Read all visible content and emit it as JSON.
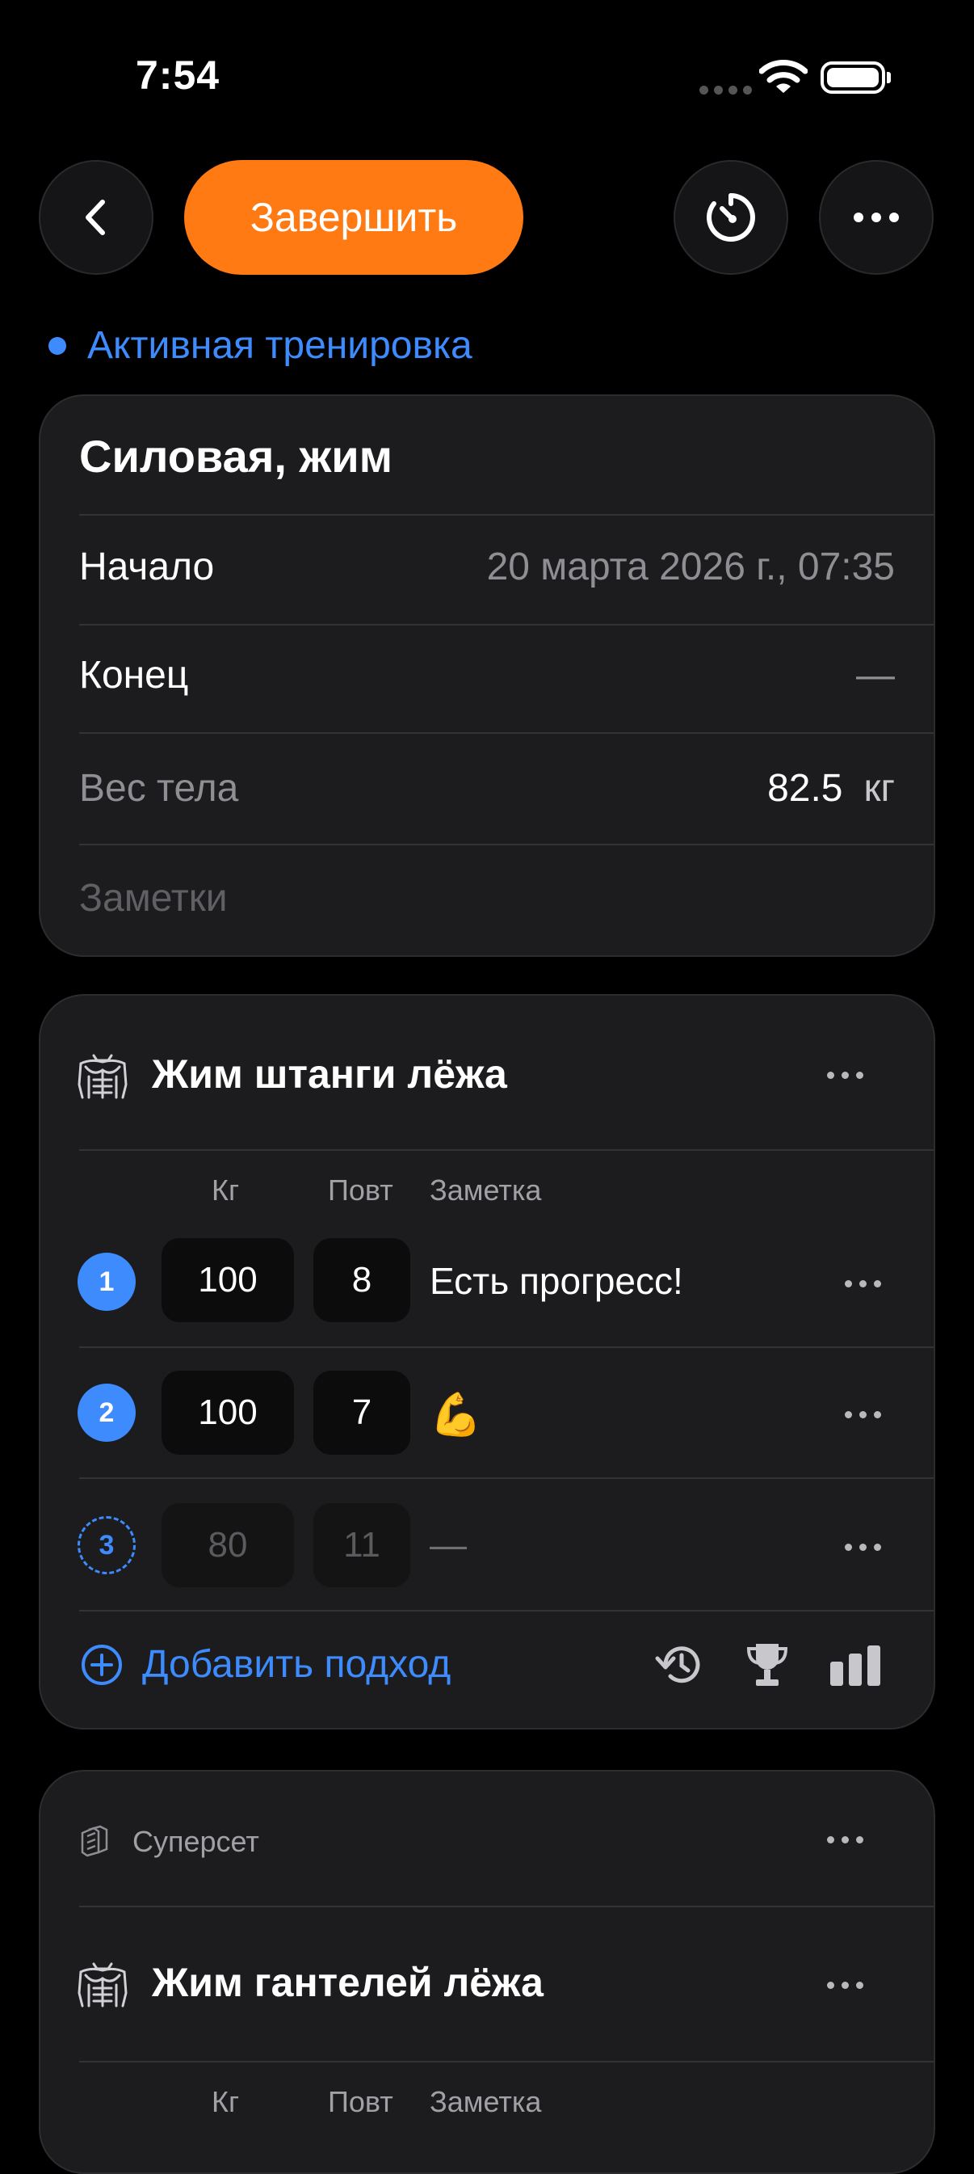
{
  "status_bar": {
    "time": "7:54"
  },
  "toolbar": {
    "finish_label": "Завершить"
  },
  "workout": {
    "status": "Активная тренировка",
    "title": "Силовая,  жим",
    "start_label": "Начало",
    "start_value": "20 марта 2026 г., 07:35",
    "end_label": "Конец",
    "end_value": "—",
    "bodyweight_label": "Вес тела",
    "bodyweight_value": "82.5",
    "bodyweight_unit": "кг",
    "notes_placeholder": "Заметки"
  },
  "exercise1": {
    "name": "Жим штанги лёжа",
    "headers": {
      "kg": "Кг",
      "reps": "Повт",
      "note": "Заметка"
    },
    "sets": [
      {
        "num": "1",
        "kg": "100",
        "reps": "8",
        "note": "Есть прогресс!"
      },
      {
        "num": "2",
        "kg": "100",
        "reps": "7",
        "note": "💪"
      },
      {
        "num": "3",
        "kg": "80",
        "reps": "11",
        "note": "—"
      }
    ],
    "add_set_label": "Добавить подход"
  },
  "superset": {
    "label": "Суперсет",
    "exercise_name": "Жим гантелей лёжа",
    "headers": {
      "kg": "Кг",
      "reps": "Повт",
      "note": "Заметка"
    }
  },
  "colors": {
    "accent": "#3d8bfd",
    "finish": "#ff7a12",
    "card": "#1c1c1e"
  }
}
